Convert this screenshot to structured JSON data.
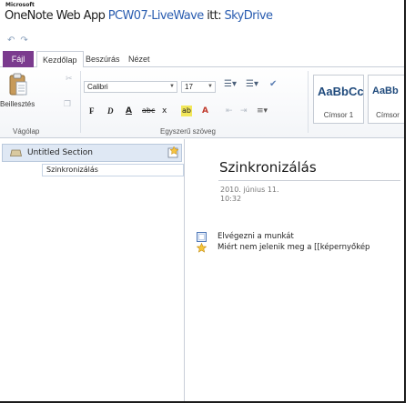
{
  "window": {
    "ms_brand": "Microsoft",
    "app_name": "OneNote Web App",
    "notebook": "PCW07-LiveWave",
    "separator": "itt:",
    "location": "SkyDrive"
  },
  "quick_access": {
    "undo_icon": "undo-icon",
    "redo_icon": "redo-icon"
  },
  "tabs": {
    "file": "Fájl",
    "home": "Kezdőlap",
    "insert": "Beszúrás",
    "view": "Nézet"
  },
  "ribbon": {
    "clipboard": {
      "paste_label": "Beillesztés",
      "group_label": "Vágólap"
    },
    "font": {
      "font_name": "Calibri",
      "font_size": "17",
      "bold": "F",
      "italic": "D",
      "underline": "A",
      "strike": "abc",
      "subscript": "x",
      "color_letter": "A",
      "highlight": "ab",
      "group_label": "Egyszerű szöveg"
    },
    "styles": {
      "style1_sample": "AaBbCc",
      "style1_name": "Címsor 1",
      "style2_sample": "AaBb",
      "style2_name": "Címsor"
    }
  },
  "navigation": {
    "section_label": "Untitled Section",
    "pages": [
      "Szinkronizálás"
    ]
  },
  "page": {
    "title": "Szinkronizálás",
    "date": "2010. június 11.",
    "time": "10:32",
    "items": [
      {
        "icon": "checkbox-icon",
        "text": "Elvégezni a munkát"
      },
      {
        "icon": "star-icon",
        "text": "Miért nem jelenik meg a [[képernyőkép"
      }
    ]
  },
  "colors": {
    "file_tab": "#7b3b8e",
    "link_blue": "#2a5db0",
    "heading_style": "#1f4a7c",
    "selected_section": "#dfe8f4"
  }
}
